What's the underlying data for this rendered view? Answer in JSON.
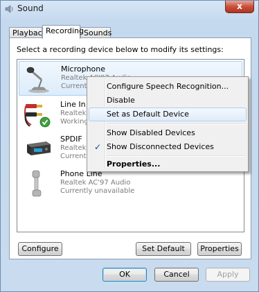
{
  "window": {
    "title": "Sound",
    "close_glyph": "x"
  },
  "tabs": [
    {
      "label": "Playback"
    },
    {
      "label": "Recording"
    },
    {
      "label": "Sounds"
    }
  ],
  "instruction": "Select a recording device below to modify its settings:",
  "devices": [
    {
      "name": "Microphone",
      "line1": "Realtek AC'97 Audio",
      "line2": "Currently unavailable",
      "icon": "microphone-icon"
    },
    {
      "name": "Line In",
      "line1": "Realtek AC'97 Audio",
      "line2": "Working",
      "icon": "line-in-cables-icon"
    },
    {
      "name": "SPDIF",
      "line1": "Realtek AC'97 Audio",
      "line2": "Currently unavailable",
      "icon": "spdif-device-icon"
    },
    {
      "name": "Phone Line",
      "line1": "Realtek AC'97 Audio",
      "line2": "Currently unavailable",
      "icon": "phone-handset-icon"
    }
  ],
  "context_menu": {
    "items": [
      {
        "label": "Configure Speech Recognition..."
      },
      {
        "label": "Disable"
      },
      {
        "label": "Set as Default Device"
      },
      {
        "label": "Show Disabled Devices"
      },
      {
        "label": "Show Disconnected Devices",
        "check": "✓"
      },
      {
        "label": "Properties..."
      }
    ]
  },
  "buttons": {
    "configure": "Configure",
    "set_default": "Set Default",
    "properties": "Properties",
    "ok": "OK",
    "cancel": "Cancel",
    "apply": "Apply"
  },
  "colors": {
    "selection": "#dcecfb",
    "check": "#1a3f8f",
    "close": "#c9503c"
  }
}
